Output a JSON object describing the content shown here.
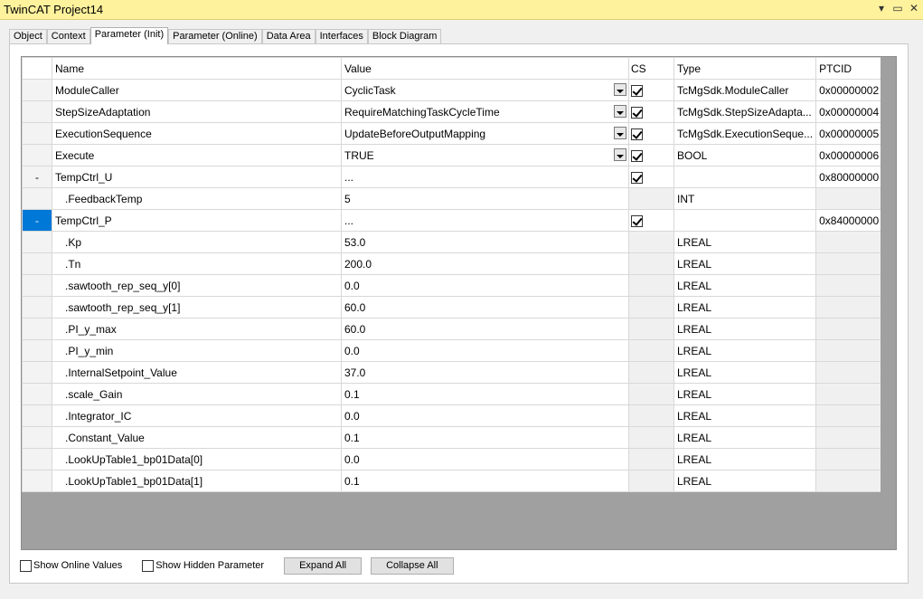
{
  "window": {
    "title": "TwinCAT Project14"
  },
  "tabs": [
    "Object",
    "Context",
    "Parameter (Init)",
    "Parameter (Online)",
    "Data Area",
    "Interfaces",
    "Block Diagram"
  ],
  "active_tab": "Parameter (Init)",
  "grid": {
    "headers": {
      "name": "Name",
      "value": "Value",
      "cs": "CS",
      "type": "Type",
      "ptcid": "PTCID"
    },
    "rows": [
      {
        "sel": "",
        "name": "ModuleCaller",
        "value": "CyclicTask",
        "dropdown": true,
        "cs": true,
        "type": "TcMgSdk.ModuleCaller",
        "ptcid": "0x00000002"
      },
      {
        "sel": "",
        "name": "StepSizeAdaptation",
        "value": "RequireMatchingTaskCycleTime",
        "dropdown": true,
        "cs": true,
        "type": "TcMgSdk.StepSizeAdapta...",
        "ptcid": "0x00000004"
      },
      {
        "sel": "",
        "name": "ExecutionSequence",
        "value": "UpdateBeforeOutputMapping",
        "dropdown": true,
        "cs": true,
        "type": "TcMgSdk.ExecutionSeque...",
        "ptcid": "0x00000005"
      },
      {
        "sel": "",
        "name": "Execute",
        "value": "TRUE",
        "dropdown": true,
        "cs": true,
        "type": "BOOL",
        "ptcid": "0x00000006"
      },
      {
        "sel": "-",
        "name": "TempCtrl_U",
        "value": "...",
        "dropdown": false,
        "cs": true,
        "type": "",
        "ptcid": "0x80000000"
      },
      {
        "sel": "",
        "name": ".FeedbackTemp",
        "value": "5",
        "dropdown": false,
        "cs": null,
        "type": "INT",
        "ptcid": "",
        "child": true
      },
      {
        "sel": "-",
        "name": "TempCtrl_P",
        "value": "...",
        "dropdown": false,
        "cs": true,
        "type": "",
        "ptcid": "0x84000000",
        "selected": true
      },
      {
        "sel": "",
        "name": ".Kp",
        "value": "53.0",
        "dropdown": false,
        "cs": null,
        "type": "LREAL",
        "ptcid": "",
        "child": true
      },
      {
        "sel": "",
        "name": ".Tn",
        "value": "200.0",
        "dropdown": false,
        "cs": null,
        "type": "LREAL",
        "ptcid": "",
        "child": true
      },
      {
        "sel": "",
        "name": ".sawtooth_rep_seq_y[0]",
        "value": "0.0",
        "dropdown": false,
        "cs": null,
        "type": "LREAL",
        "ptcid": "",
        "child": true
      },
      {
        "sel": "",
        "name": ".sawtooth_rep_seq_y[1]",
        "value": "60.0",
        "dropdown": false,
        "cs": null,
        "type": "LREAL",
        "ptcid": "",
        "child": true
      },
      {
        "sel": "",
        "name": ".PI_y_max",
        "value": "60.0",
        "dropdown": false,
        "cs": null,
        "type": "LREAL",
        "ptcid": "",
        "child": true
      },
      {
        "sel": "",
        "name": ".PI_y_min",
        "value": "0.0",
        "dropdown": false,
        "cs": null,
        "type": "LREAL",
        "ptcid": "",
        "child": true
      },
      {
        "sel": "",
        "name": ".InternalSetpoint_Value",
        "value": "37.0",
        "dropdown": false,
        "cs": null,
        "type": "LREAL",
        "ptcid": "",
        "child": true
      },
      {
        "sel": "",
        "name": ".scale_Gain",
        "value": "0.1",
        "dropdown": false,
        "cs": null,
        "type": "LREAL",
        "ptcid": "",
        "child": true
      },
      {
        "sel": "",
        "name": ".Integrator_IC",
        "value": "0.0",
        "dropdown": false,
        "cs": null,
        "type": "LREAL",
        "ptcid": "",
        "child": true
      },
      {
        "sel": "",
        "name": ".Constant_Value",
        "value": "0.1",
        "dropdown": false,
        "cs": null,
        "type": "LREAL",
        "ptcid": "",
        "child": true
      },
      {
        "sel": "",
        "name": ".LookUpTable1_bp01Data[0]",
        "value": "0.0",
        "dropdown": false,
        "cs": null,
        "type": "LREAL",
        "ptcid": "",
        "child": true
      },
      {
        "sel": "",
        "name": ".LookUpTable1_bp01Data[1]",
        "value": "0.1",
        "dropdown": false,
        "cs": null,
        "type": "LREAL",
        "ptcid": "",
        "child": true
      }
    ]
  },
  "bottom": {
    "show_online_values": "Show Online Values",
    "show_hidden_parameter": "Show Hidden Parameter",
    "expand_all": "Expand All",
    "collapse_all": "Collapse All"
  },
  "colors": {
    "titlebar": "#fff29d",
    "selection": "#0078d7",
    "grid_background": "#a0a0a0"
  },
  "icons": {
    "minimize": "chevron-down-icon",
    "restore": "restore-icon",
    "close": "close-icon"
  }
}
